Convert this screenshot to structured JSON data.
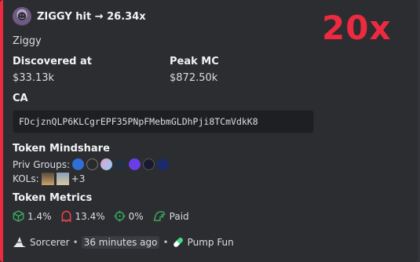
{
  "author": {
    "name": "ZIGGY hit → 26.34x",
    "avatar_icon": "ziggy-avatar"
  },
  "multiplier": "20x",
  "description": "Ziggy",
  "fields": {
    "discovered": {
      "title": "Discovered at",
      "value": "$33.13k"
    },
    "peak": {
      "title": "Peak MC",
      "value": "$872.50k"
    }
  },
  "ca": {
    "title": "CA",
    "value": "FDcjznQLP6KLCgrEPF35PNpFMebmGLDhPji8TCmVdkK8"
  },
  "mindshare": {
    "title": "Token Mindshare",
    "priv_label": "Priv Groups:",
    "kols_label": "KOLs:",
    "kols_more": "+3"
  },
  "metrics": {
    "title": "Token Metrics",
    "items": [
      {
        "icon": "cube-icon",
        "value": "1.4%",
        "color": "#3ba55c"
      },
      {
        "icon": "ghost-icon",
        "value": "13.4%",
        "color": "#ed4245"
      },
      {
        "icon": "crosshair-icon",
        "value": "0%",
        "color": "#3ba55c"
      },
      {
        "icon": "dex-paid-icon",
        "value": "Paid",
        "color": "#3ba55c"
      }
    ]
  },
  "footer": {
    "bot": "Sorcerer",
    "time": "36 minutes ago",
    "platform": "Pump Fun",
    "separator": "•"
  },
  "colors": {
    "accent": "#ed2a3f",
    "embed_bg": "#2b2d31",
    "page_bg": "#313338"
  }
}
